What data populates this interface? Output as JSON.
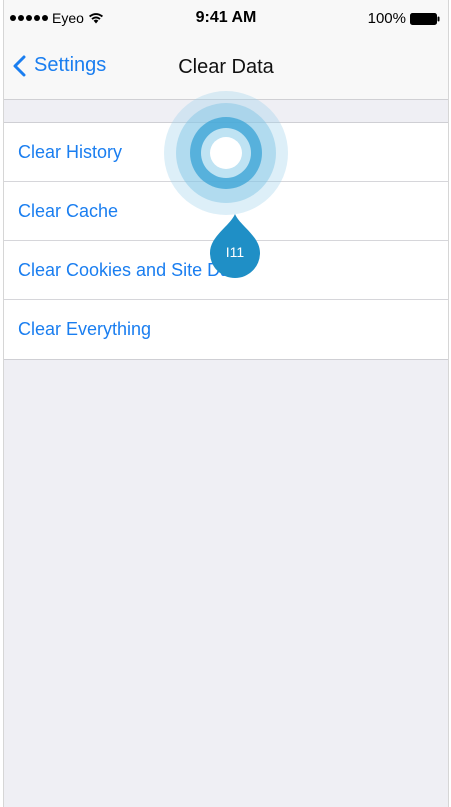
{
  "status_bar": {
    "carrier": "Eyeo",
    "time": "9:41 AM",
    "battery": "100%",
    "signal_icon": "signal-dots-icon",
    "wifi_icon": "wifi-icon",
    "battery_icon": "battery-icon"
  },
  "nav": {
    "back_label": "Settings",
    "back_icon": "chevron-left-icon",
    "title": "Clear Data"
  },
  "list": {
    "items": [
      {
        "label": "Clear History"
      },
      {
        "label": "Clear Cache"
      },
      {
        "label": "Clear Cookies and Site Data"
      },
      {
        "label": "Clear Everything"
      }
    ]
  },
  "touch": {
    "label": "I11",
    "icon": "touch-indicator-icon"
  },
  "colors": {
    "accent": "#1a7ef0",
    "background": "#efeff4",
    "bar": "#f8f8f8",
    "touch": "#1f8fc6"
  }
}
